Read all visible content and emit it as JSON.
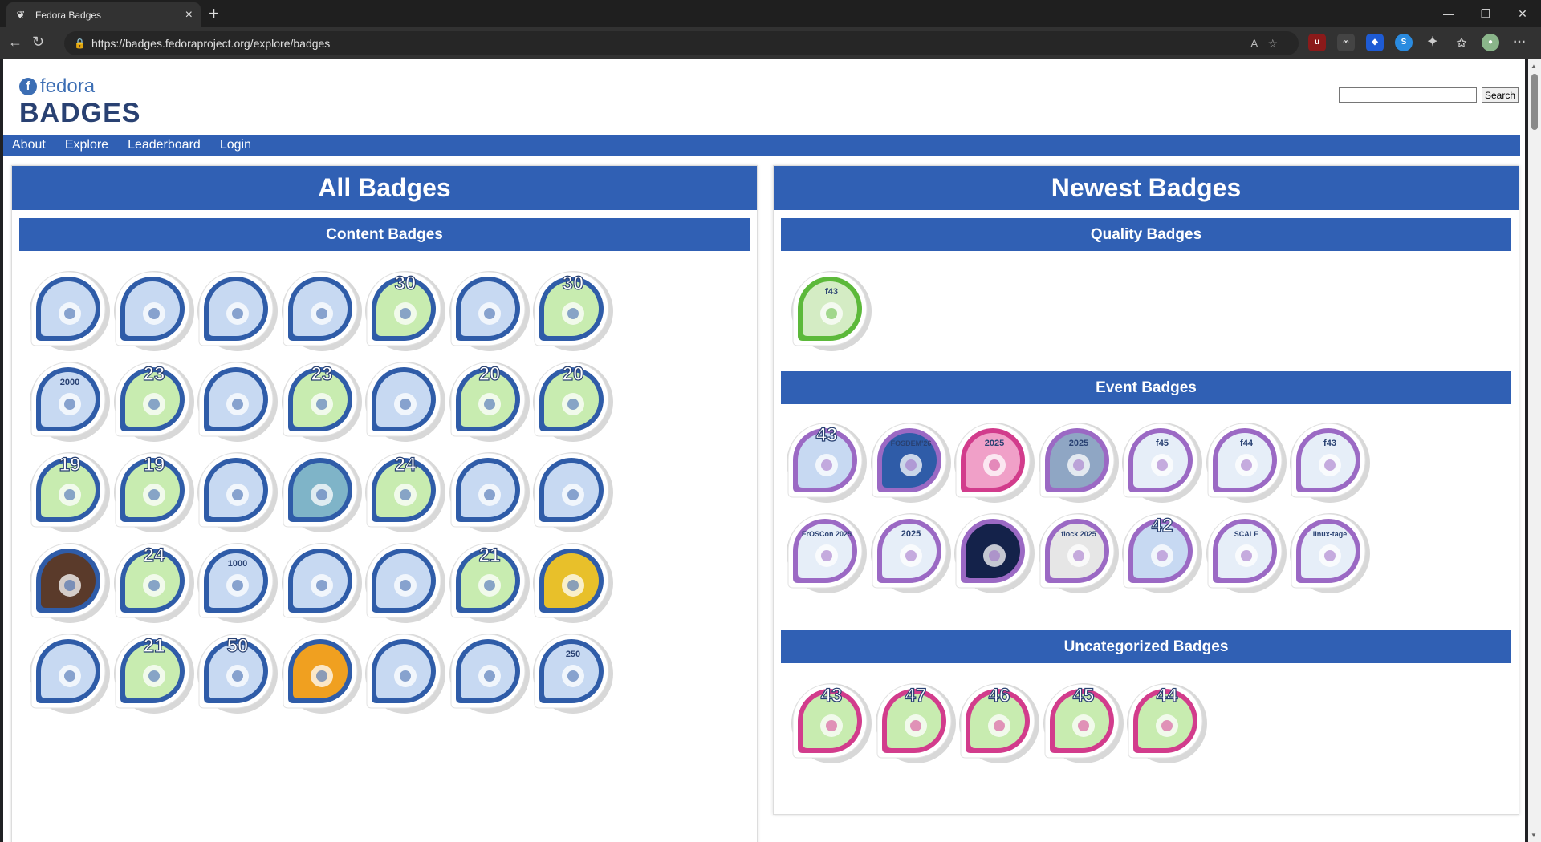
{
  "browser": {
    "tab_title": "Fedora Badges",
    "url": "https://badges.fedoraproject.org/explore/badges",
    "new_tab": "+",
    "close_tab": "×"
  },
  "site": {
    "brand_top": "fedora",
    "brand_bottom": "BADGES",
    "search_placeholder": "",
    "search_button": "Search",
    "nav": [
      "About",
      "Explore",
      "Leaderboard",
      "Login"
    ]
  },
  "left": {
    "title": "All Badges",
    "section": "Content Badges",
    "badges": [
      {
        "icon": "classroom-pandas-badge",
        "ring": "#2f5ca8",
        "bg": "#c7d9f2",
        "label": ""
      },
      {
        "icon": "hairnet-badge",
        "ring": "#2f5ca8",
        "bg": "#c7d9f2",
        "label": ""
      },
      {
        "icon": "bandana-badge",
        "ring": "#2f5ca8",
        "bg": "#c7d9f2",
        "label": ""
      },
      {
        "icon": "chef-hat-badge",
        "ring": "#2f5ca8",
        "bg": "#c7d9f2",
        "label": ""
      },
      {
        "icon": "camera-panda-badge",
        "ring": "#2f5ca8",
        "bg": "#c8ecb0",
        "label": "30"
      },
      {
        "icon": "sailor-hat-badge",
        "ring": "#2f5ca8",
        "bg": "#c7d9f2",
        "label": ""
      },
      {
        "icon": "camera-panda-check-badge",
        "ring": "#2f5ca8",
        "bg": "#c8ecb0",
        "label": "30"
      },
      {
        "icon": "scroll-quill-badge",
        "ring": "#2f5ca8",
        "bg": "#c7d9f2",
        "label": "2000"
      },
      {
        "icon": "camera-panda-check-badge",
        "ring": "#2f5ca8",
        "bg": "#c8ecb0",
        "label": "23"
      },
      {
        "icon": "panda-flag-badge",
        "ring": "#2f5ca8",
        "bg": "#c7d9f2",
        "label": ""
      },
      {
        "icon": "camera-panda-badge",
        "ring": "#2f5ca8",
        "bg": "#c8ecb0",
        "label": "23"
      },
      {
        "icon": "panda-flag-badge",
        "ring": "#2f5ca8",
        "bg": "#c7d9f2",
        "label": ""
      },
      {
        "icon": "camera-panda-badge",
        "ring": "#2f5ca8",
        "bg": "#c8ecb0",
        "label": "20"
      },
      {
        "icon": "camera-panda-check-badge",
        "ring": "#2f5ca8",
        "bg": "#c8ecb0",
        "label": "20"
      },
      {
        "icon": "camera-panda-badge",
        "ring": "#2f5ca8",
        "bg": "#c8ecb0",
        "label": "19"
      },
      {
        "icon": "camera-panda-check-badge",
        "ring": "#2f5ca8",
        "bg": "#c8ecb0",
        "label": "19"
      },
      {
        "icon": "panda-broom-badge",
        "ring": "#2f5ca8",
        "bg": "#c7d9f2",
        "label": ""
      },
      {
        "icon": "spider-badge",
        "ring": "#2f5ca8",
        "bg": "#7fb4c8",
        "label": ""
      },
      {
        "icon": "camera-panda-badge",
        "ring": "#2f5ca8",
        "bg": "#c8ecb0",
        "label": "24"
      },
      {
        "icon": "panda-wave-badge",
        "ring": "#2f5ca8",
        "bg": "#c7d9f2",
        "label": ""
      },
      {
        "icon": "orange-panda-badge",
        "ring": "#2f5ca8",
        "bg": "#c7d9f2",
        "label": ""
      },
      {
        "icon": "panda-desk-badge",
        "ring": "#2f5ca8",
        "bg": "#5a3a2a",
        "label": ""
      },
      {
        "icon": "camera-panda-check-badge",
        "ring": "#2f5ca8",
        "bg": "#c8ecb0",
        "label": "24"
      },
      {
        "icon": "typewriter-badge",
        "ring": "#2f5ca8",
        "bg": "#c7d9f2",
        "label": "1000"
      },
      {
        "icon": "crossed-quills-badge",
        "ring": "#2f5ca8",
        "bg": "#c7d9f2",
        "label": ""
      },
      {
        "icon": "fountain-pen-badge",
        "ring": "#2f5ca8",
        "bg": "#c7d9f2",
        "label": ""
      },
      {
        "icon": "camera-panda-badge",
        "ring": "#2f5ca8",
        "bg": "#c8ecb0",
        "label": "21"
      },
      {
        "icon": "tribal-mask-badge",
        "ring": "#2f5ca8",
        "bg": "#e8c02a",
        "label": ""
      },
      {
        "icon": "orange-panda-glasses-badge",
        "ring": "#2f5ca8",
        "bg": "#c7d9f2",
        "label": ""
      },
      {
        "icon": "camera-panda-check-badge",
        "ring": "#2f5ca8",
        "bg": "#c8ecb0",
        "label": "21"
      },
      {
        "icon": "scroll-quill-badge",
        "ring": "#2f5ca8",
        "bg": "#c7d9f2",
        "label": "50"
      },
      {
        "icon": "blue-figure-badge",
        "ring": "#2f5ca8",
        "bg": "#f0a020",
        "label": ""
      },
      {
        "icon": "map-boxes-badge",
        "ring": "#2f5ca8",
        "bg": "#c7d9f2",
        "label": ""
      },
      {
        "icon": "panda-flag-badge",
        "ring": "#2f5ca8",
        "bg": "#c7d9f2",
        "label": ""
      },
      {
        "icon": "scroll-quill-badge",
        "ring": "#2f5ca8",
        "bg": "#c7d9f2",
        "label": "250"
      }
    ]
  },
  "right": {
    "title": "Newest Badges",
    "sections": [
      {
        "name": "Quality Badges",
        "badges": [
          {
            "icon": "test-machine-badge",
            "ring": "#5cb93a",
            "bg": "#d4ecc4",
            "label": "f43"
          }
        ]
      },
      {
        "name": "Event Badges",
        "badges": [
          {
            "icon": "release-party-43-badge",
            "ring": "#9b69c4",
            "bg": "#c7d9f2",
            "label": "43"
          },
          {
            "icon": "fosdem-26-badge",
            "ring": "#9b69c4",
            "bg": "#2f5ca8",
            "label": "FOSDEM'26"
          },
          {
            "icon": "bird-2025-badge",
            "ring": "#d23c8c",
            "bg": "#f0a0c8",
            "label": "2025"
          },
          {
            "icon": "star-2025-badge",
            "ring": "#9b69c4",
            "bg": "#8fa6c4",
            "label": "2025"
          },
          {
            "icon": "i18n-f45-badge",
            "ring": "#9b69c4",
            "bg": "#e6eef8",
            "label": "f45"
          },
          {
            "icon": "i18n-f44-badge",
            "ring": "#9b69c4",
            "bg": "#e6eef8",
            "label": "f44"
          },
          {
            "icon": "i18n-f43-badge",
            "ring": "#9b69c4",
            "bg": "#e6eef8",
            "label": "f43"
          },
          {
            "icon": "froscon-2025-badge",
            "ring": "#9b69c4",
            "bg": "#e6eef8",
            "label": "FrOSCon 2025"
          },
          {
            "icon": "devconf-2025-badge",
            "ring": "#9b69c4",
            "bg": "#e6eef8",
            "label": "2025"
          },
          {
            "icon": "space-panda-badge",
            "ring": "#9b69c4",
            "bg": "#14224a",
            "label": ""
          },
          {
            "icon": "flock-2025-badge",
            "ring": "#9b69c4",
            "bg": "#e6e6e6",
            "label": "flock 2025"
          },
          {
            "icon": "release-party-42-badge",
            "ring": "#9b69c4",
            "bg": "#c7d9f2",
            "label": "42"
          },
          {
            "icon": "scale-22x-badge",
            "ring": "#9b69c4",
            "bg": "#e6eef8",
            "label": "SCALE"
          },
          {
            "icon": "linux-tage-badge",
            "ring": "#9b69c4",
            "bg": "#e6eef8",
            "label": "linux-tage"
          }
        ]
      },
      {
        "name": "Uncategorized Badges",
        "badges": [
          {
            "icon": "ballot-43-badge",
            "ring": "#d23c8c",
            "bg": "#c8ecb0",
            "label": "43"
          },
          {
            "icon": "ballot-47-badge",
            "ring": "#d23c8c",
            "bg": "#c8ecb0",
            "label": "47"
          },
          {
            "icon": "ballot-46-badge",
            "ring": "#d23c8c",
            "bg": "#c8ecb0",
            "label": "46"
          },
          {
            "icon": "ballot-45-badge",
            "ring": "#d23c8c",
            "bg": "#c8ecb0",
            "label": "45"
          },
          {
            "icon": "ballot-44-badge",
            "ring": "#d23c8c",
            "bg": "#c8ecb0",
            "label": "44"
          }
        ]
      }
    ]
  }
}
